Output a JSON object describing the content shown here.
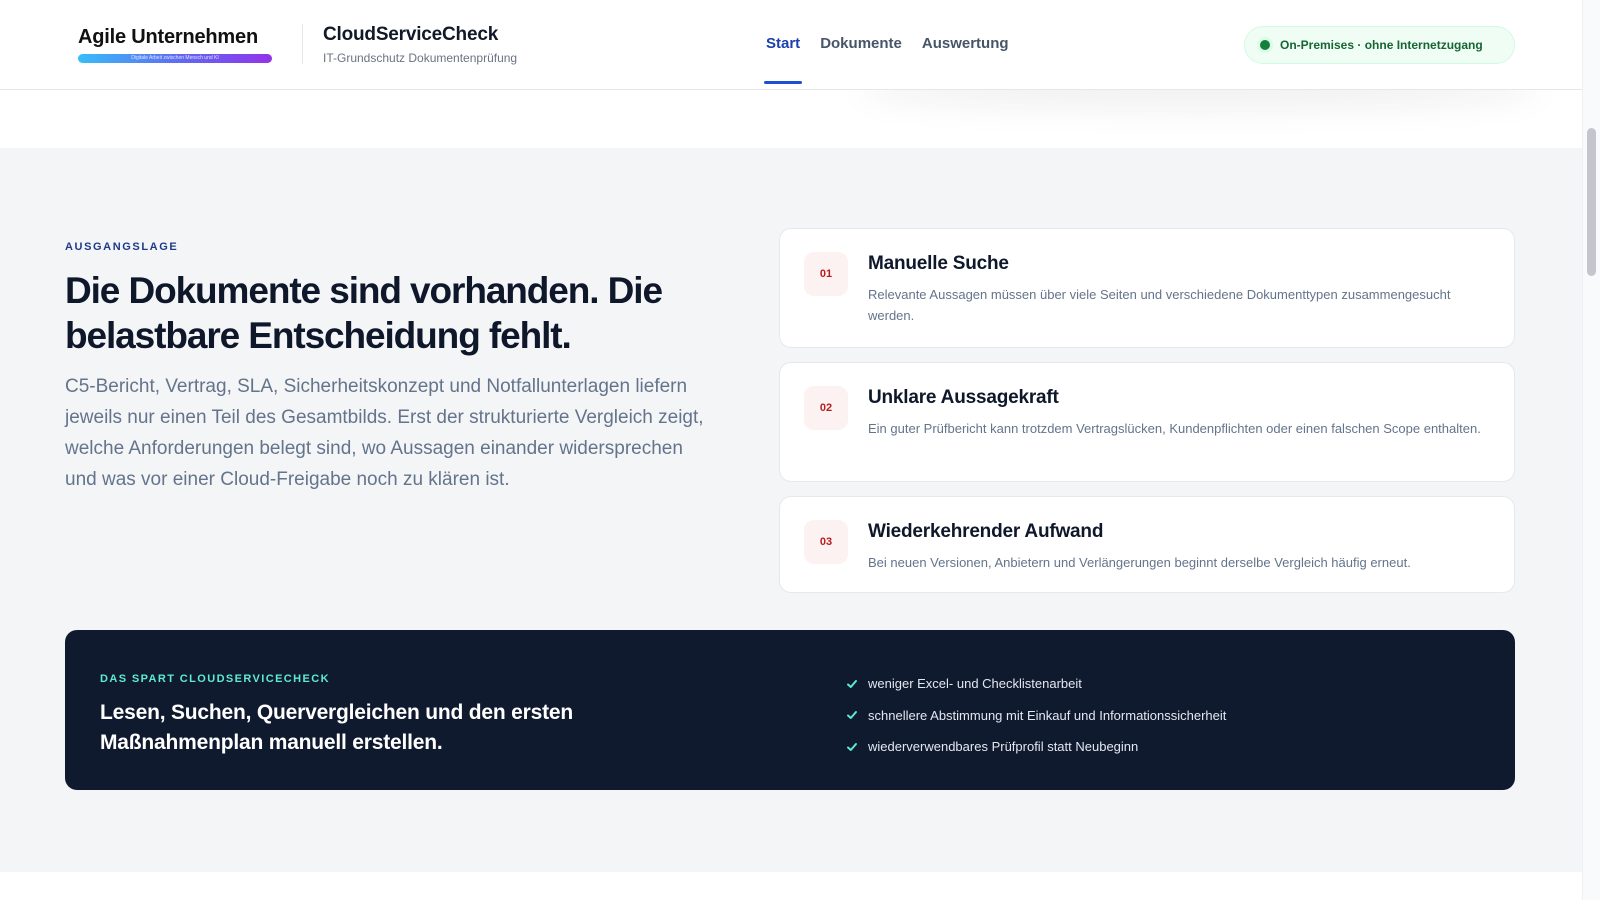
{
  "header": {
    "brand": {
      "name": "Agile Unternehmen",
      "tagline": "Digitale Arbeit zwischen Mensch und KI"
    },
    "product": {
      "name": "CloudServiceCheck",
      "subtitle": "IT-Grundschutz Dokumentenprüfung"
    },
    "nav": [
      {
        "label": "Start",
        "active": true
      },
      {
        "label": "Dokumente",
        "active": false
      },
      {
        "label": "Auswertung",
        "active": false
      }
    ],
    "status_badge": "On-Premises · ohne Internetzugang"
  },
  "intro": {
    "eyebrow": "AUSGANGSLAGE",
    "headline": "Die Dokumente sind vorhanden. Die belastbare Entscheidung fehlt.",
    "lead": "C5-Bericht, Vertrag, SLA, Sicherheitskonzept und Notfallunterlagen liefern jeweils nur einen Teil des Gesamtbilds. Erst der strukturierte Vergleich zeigt, welche Anforderungen belegt sind, wo Aussagen einander widersprechen und was vor einer Cloud-Freigabe noch zu klären ist."
  },
  "cards": [
    {
      "number": "01",
      "title": "Manuelle Suche",
      "text": "Relevante Aussagen müssen über viele Seiten und verschiedene Dokumenttypen zusammengesucht werden."
    },
    {
      "number": "02",
      "title": "Unklare Aussagekraft",
      "text": "Ein guter Prüfbericht kann trotzdem Vertragslücken, Kundenpflichten oder einen falschen Scope enthalten."
    },
    {
      "number": "03",
      "title": "Wiederkehrender Aufwand",
      "text": "Bei neuen Versionen, Anbietern und Verlängerungen beginnt derselbe Vergleich häufig erneut."
    }
  ],
  "callout": {
    "eyebrow": "DAS SPART CLOUDSERVICECHECK",
    "title": "Lesen, Suchen, Quervergleichen und den ersten Maßnahmenplan manuell erstellen.",
    "benefits": [
      "weniger Excel- und Checklistenarbeit",
      "schnellere Abstimmung mit Einkauf und Informationssicherheit",
      "wiederverwendbares Prüfprofil statt Neubeginn"
    ]
  },
  "colors": {
    "accent": "#1e40af",
    "card_number": "#b91c1c",
    "callout_bg": "#101a2f",
    "callout_eyebrow": "#5eead4",
    "status_green": "#15803d"
  }
}
